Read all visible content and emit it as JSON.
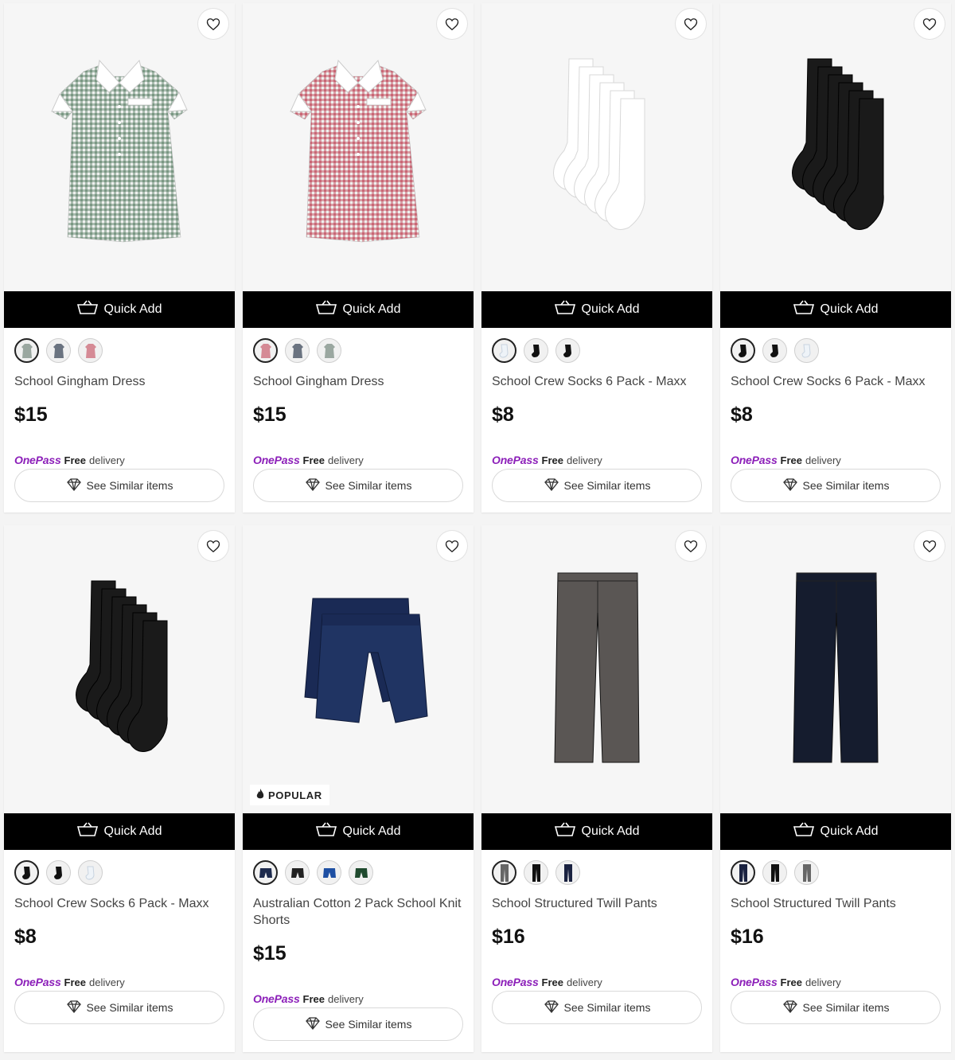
{
  "common": {
    "quick_add_label": "Quick Add",
    "onepass_label": "OnePass",
    "free_label": "Free",
    "delivery_label": "delivery",
    "see_similar_label": "See Similar items",
    "popular_label": "POPULAR"
  },
  "products": [
    {
      "name": "School Gingham Dress",
      "price": "$15",
      "image": "green-gingham-dress",
      "swatches": [
        "green-dress",
        "grey-dress",
        "red-dress"
      ],
      "selected": 0
    },
    {
      "name": "School Gingham Dress",
      "price": "$15",
      "image": "red-gingham-dress",
      "swatches": [
        "red-dress",
        "grey-dress",
        "green-dress"
      ],
      "selected": 0
    },
    {
      "name": "School Crew Socks 6 Pack - Maxx",
      "price": "$8",
      "image": "white-socks",
      "swatches": [
        "white-socks",
        "black-socks",
        "black-socks"
      ],
      "selected": 0
    },
    {
      "name": "School Crew Socks 6 Pack - Maxx",
      "price": "$8",
      "image": "black-socks",
      "swatches": [
        "black-socks",
        "black-socks",
        "white-socks"
      ],
      "selected": 0
    },
    {
      "name": "School Crew Socks 6 Pack - Maxx",
      "price": "$8",
      "image": "black-socks",
      "swatches": [
        "black-socks",
        "black-socks",
        "white-socks"
      ],
      "selected": 0
    },
    {
      "name": "Australian Cotton 2 Pack School Knit Shorts",
      "price": "$15",
      "image": "navy-shorts",
      "popular": true,
      "swatches": [
        "navy-shorts",
        "black-shorts",
        "blue-shorts",
        "green-shorts"
      ],
      "selected": 0
    },
    {
      "name": "School Structured Twill Pants",
      "price": "$16",
      "image": "grey-pants",
      "swatches": [
        "grey-pants",
        "black-pants",
        "navy-pants"
      ],
      "selected": 0
    },
    {
      "name": "School Structured Twill Pants",
      "price": "$16",
      "image": "navy-pants",
      "swatches": [
        "navy-pants",
        "black-pants",
        "grey-pants"
      ],
      "selected": 0
    }
  ],
  "colors": {
    "onepass_purple": "#8c1fb9",
    "quick_add_bg": "#000000",
    "green_gingham": "#6f8f7a",
    "red_gingham": "#c65a6a",
    "navy": "#1d2a4d",
    "charcoal": "#555555"
  }
}
